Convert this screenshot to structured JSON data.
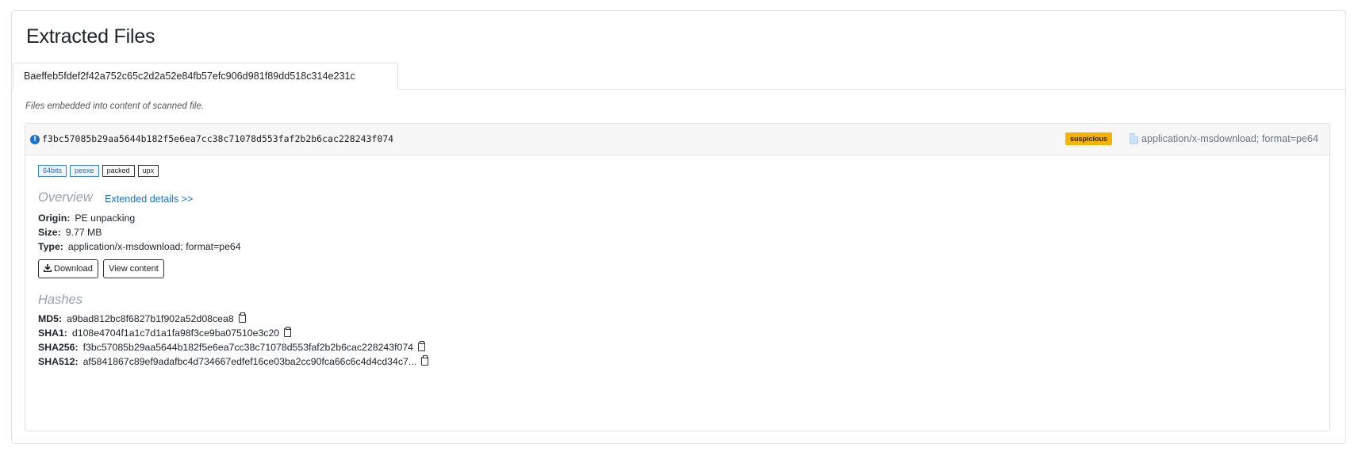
{
  "card_title": "Extracted Files",
  "tab_label": "Baeffeb5fdef2f42a752c65c2d2a52e84fb57efc906d981f89dd518c314e231c",
  "description": "Files embedded into content of scanned file.",
  "file": {
    "hash": "f3bc57085b29aa5644b182f5e6ea7cc38c71078d553faf2b2b6cac228243f074",
    "verdict": "suspicious",
    "verdict_color": "#f5b400",
    "mime": "application/x-msdownload; format=pe64",
    "tags": [
      {
        "label": "64bits",
        "style": "blue"
      },
      {
        "label": "peexe",
        "style": "blue"
      },
      {
        "label": "packed",
        "style": "plain"
      },
      {
        "label": "upx",
        "style": "plain"
      }
    ]
  },
  "overview": {
    "title": "Overview",
    "extended_link": "Extended details >>",
    "origin_label": "Origin:",
    "origin_value": "PE unpacking",
    "size_label": "Size:",
    "size_value": "9.77 MB",
    "type_label": "Type:",
    "type_value": "application/x-msdownload; format=pe64",
    "download_label": "Download",
    "view_label": "View content"
  },
  "hashes": {
    "title": "Hashes",
    "md5_label": "MD5:",
    "md5": "a9bad812bc8f6827b1f902a52d08cea8",
    "sha1_label": "SHA1:",
    "sha1": "d108e4704f1a1c7d1a1fa98f3ce9ba07510e3c20",
    "sha256_label": "SHA256:",
    "sha256": "f3bc57085b29aa5644b182f5e6ea7cc38c71078d553faf2b2b6cac228243f074",
    "sha512_label": "SHA512:",
    "sha512": "af5841867c89ef9adafbc4d734667edfef16ce03ba2cc90fca66c6c4d4cd34c7..."
  },
  "icons": {
    "info": "info-circle-icon",
    "file": "file-icon",
    "download": "download-icon",
    "copy": "clipboard-icon"
  }
}
